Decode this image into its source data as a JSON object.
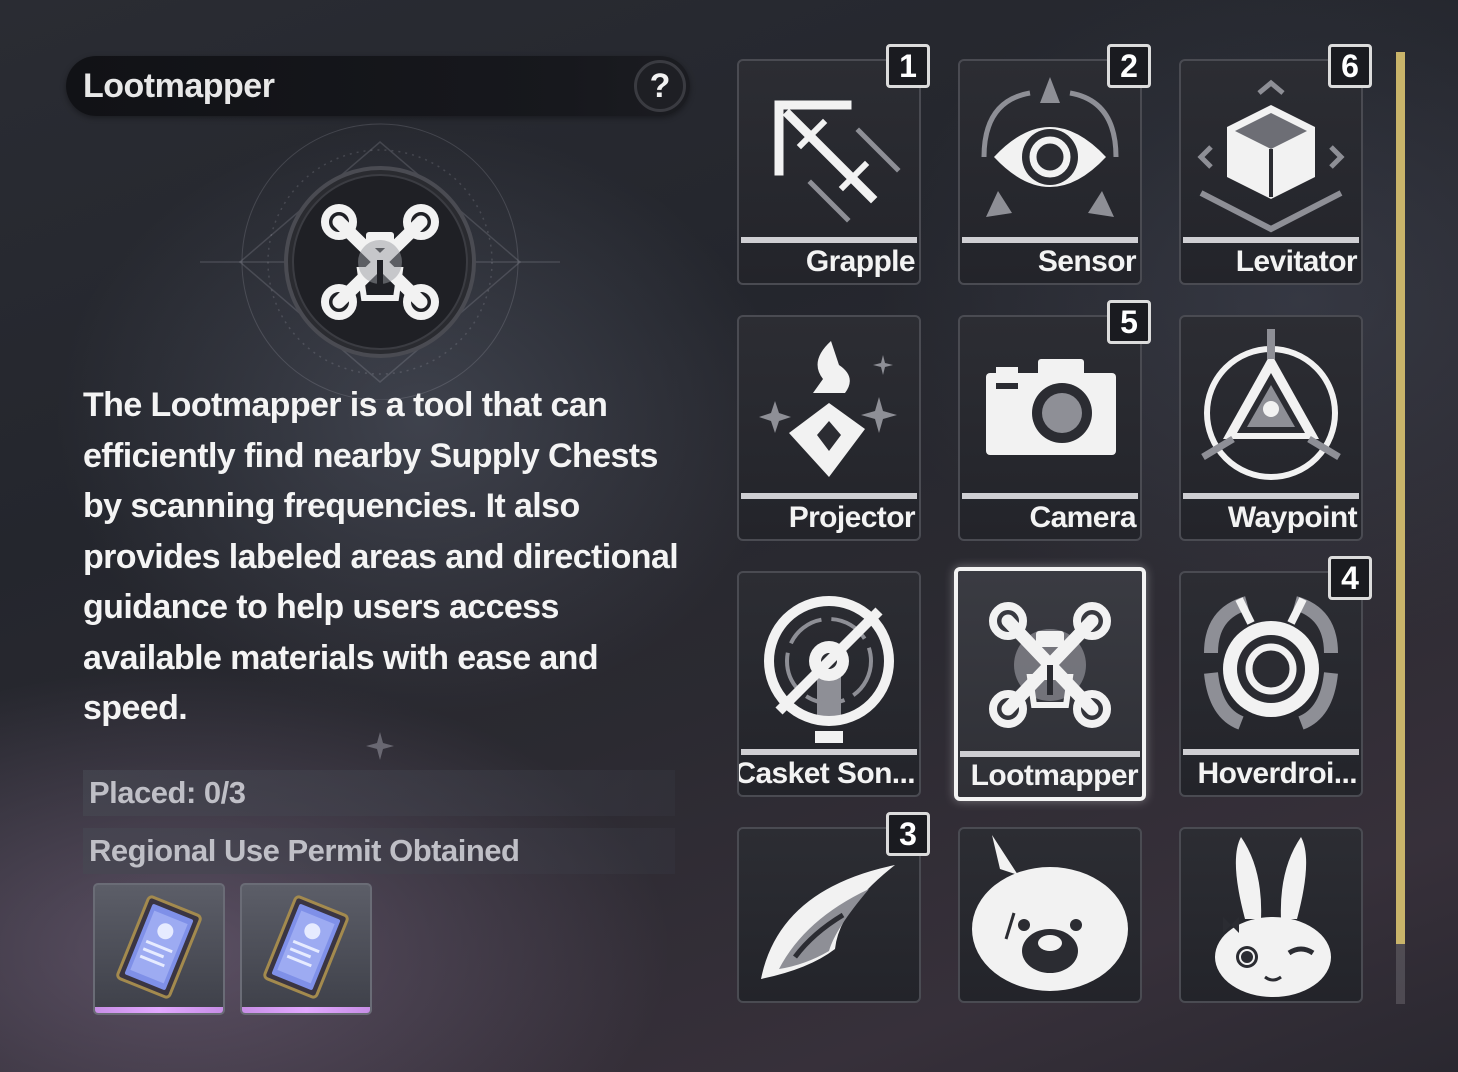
{
  "header": {
    "title": "Lootmapper",
    "help_symbol": "?"
  },
  "description": "The Lootmapper is a tool that can efficiently find nearby Supply Chests by scanning frequencies. It also provides labeled areas and directional guidance to help users access available materials with ease and speed.",
  "info": {
    "placed": "Placed: 0/3",
    "permit": "Regional Use Permit Obtained"
  },
  "permits": [
    {
      "name": "permit-card-1",
      "rarity_color": "#d9a0f5"
    },
    {
      "name": "permit-card-2",
      "rarity_color": "#d9a0f5"
    }
  ],
  "tools": [
    {
      "label": "Grapple",
      "badge": "1",
      "icon": "grapple-icon"
    },
    {
      "label": "Sensor",
      "badge": "2",
      "icon": "sensor-icon"
    },
    {
      "label": "Levitator",
      "badge": "6",
      "icon": "levitator-icon"
    },
    {
      "label": "Projector",
      "badge": "",
      "icon": "projector-icon"
    },
    {
      "label": "Camera",
      "badge": "5",
      "icon": "camera-icon"
    },
    {
      "label": "Waypoint",
      "badge": "",
      "icon": "waypoint-icon"
    },
    {
      "label": "Casket Son...",
      "badge": "",
      "icon": "casket-sonar-icon"
    },
    {
      "label": "Lootmapper",
      "badge": "",
      "icon": "lootmapper-icon",
      "selected": true
    },
    {
      "label": "Hoverdroi...",
      "badge": "4",
      "icon": "hoverdroid-icon"
    },
    {
      "label": "",
      "badge": "3",
      "icon": "wing-icon"
    },
    {
      "label": "",
      "badge": "",
      "icon": "bear-face-icon"
    },
    {
      "label": "",
      "badge": "",
      "icon": "rabbit-face-icon"
    }
  ],
  "colors": {
    "scroll_thumb": "#c9b46a",
    "selected_border": "#f3f3f3",
    "permit_rarity": "#d9a0f5"
  }
}
